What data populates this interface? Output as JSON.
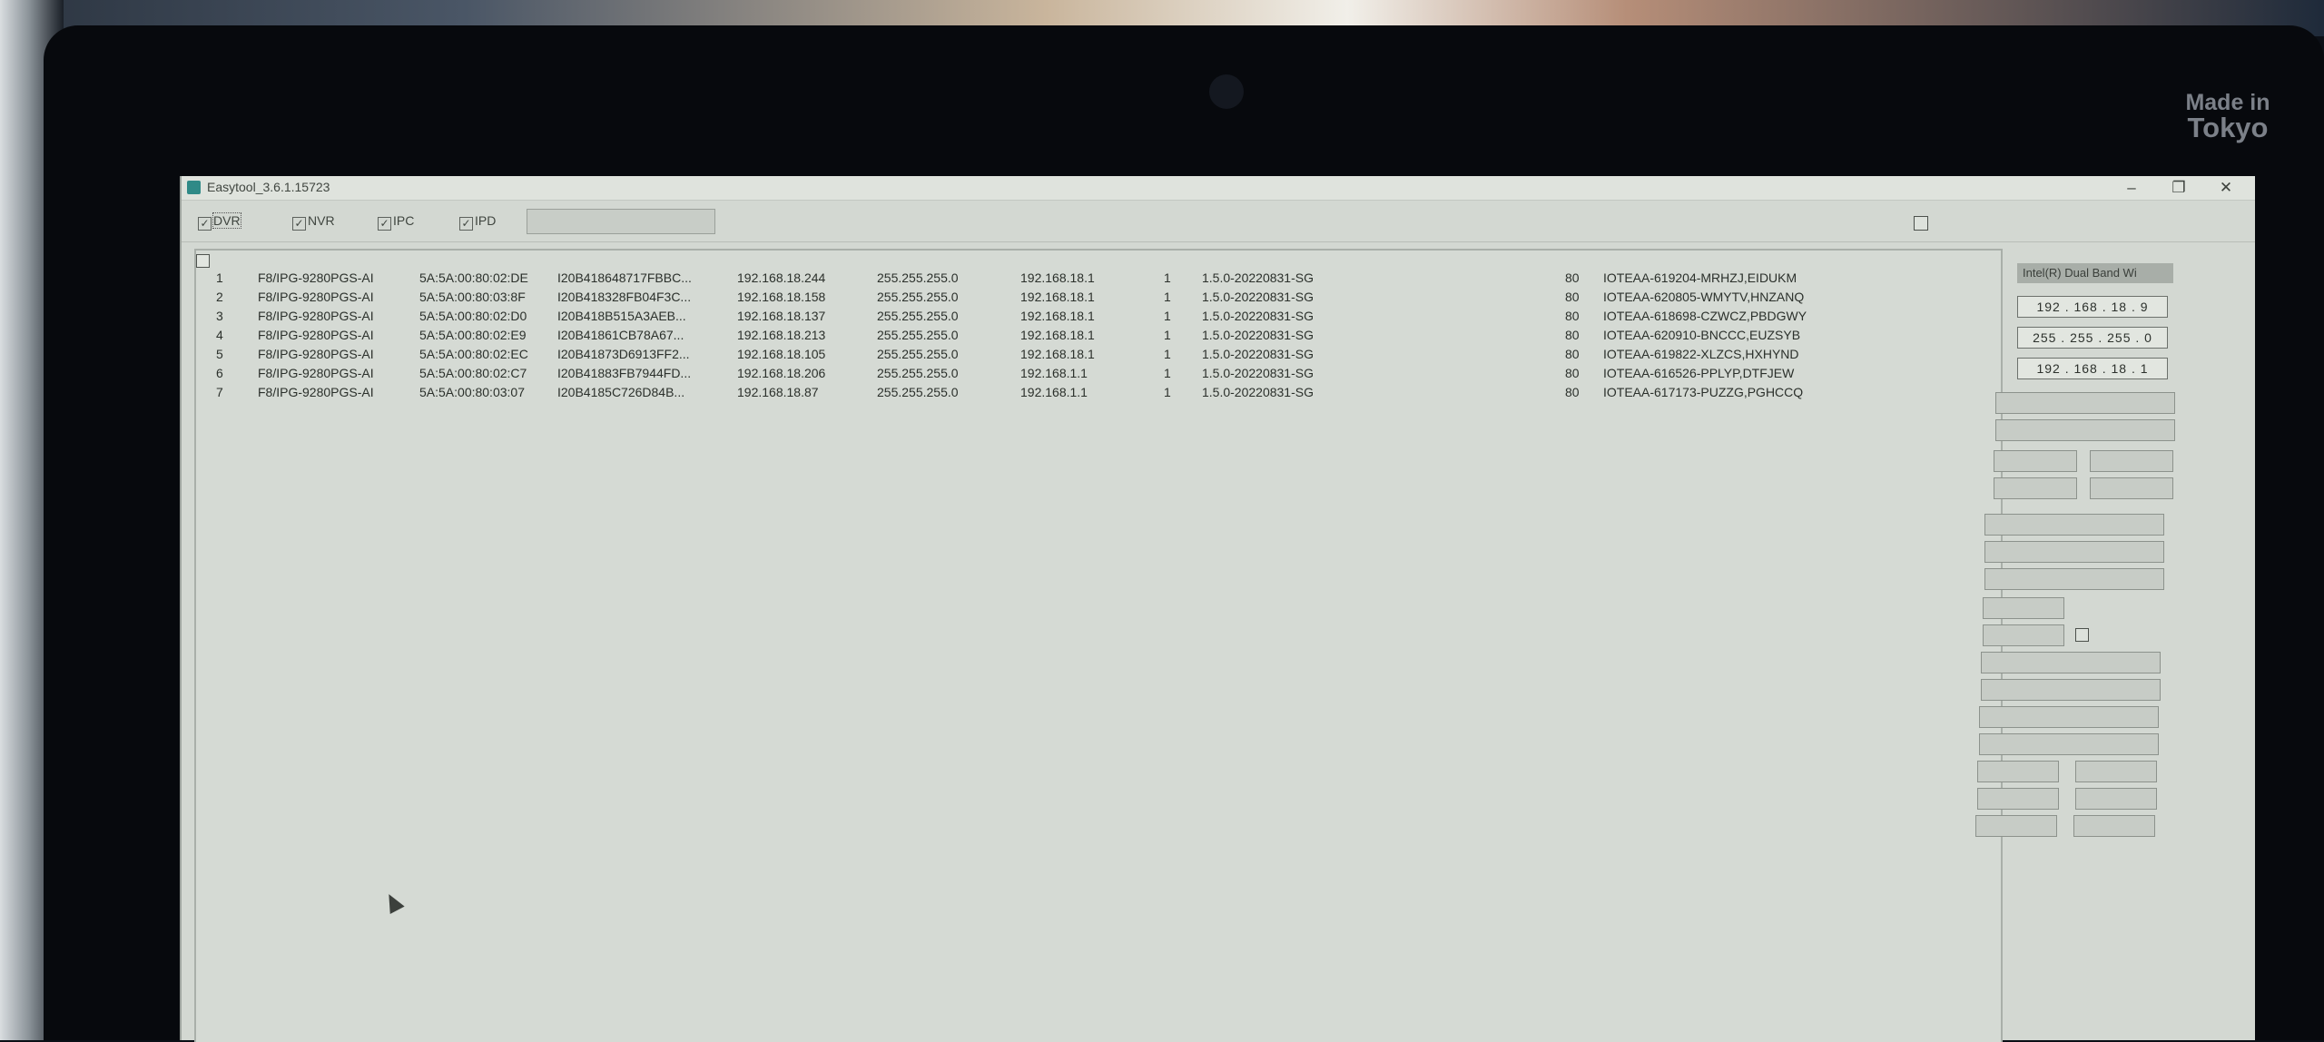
{
  "brand": {
    "line1": "Made in",
    "line2": "Tokyo"
  },
  "window": {
    "title": "Easytool_3.6.1.15723",
    "minimize": "–",
    "maximize": "❐",
    "close": "✕"
  },
  "filters": [
    {
      "label": "DVR",
      "checked": true
    },
    {
      "label": "NVR",
      "checked": true
    },
    {
      "label": "IPC",
      "checked": true
    },
    {
      "label": "IPD",
      "checked": true
    }
  ],
  "search": {
    "value": ""
  },
  "devices": [
    {
      "no": "1",
      "model": "F8/IPG-9280PGS-AI",
      "mac": "5A:5A:00:80:02:DE",
      "serial": "I20B418648717FBBC...",
      "ip": "192.168.18.244",
      "mask": "255.255.255.0",
      "gateway": "192.168.18.1",
      "channels": "1",
      "version": "1.5.0-20220831-SG",
      "port": "80",
      "name": "IOTEAA-619204-MRHZJ,EIDUKM"
    },
    {
      "no": "2",
      "model": "F8/IPG-9280PGS-AI",
      "mac": "5A:5A:00:80:03:8F",
      "serial": "I20B418328FB04F3C...",
      "ip": "192.168.18.158",
      "mask": "255.255.255.0",
      "gateway": "192.168.18.1",
      "channels": "1",
      "version": "1.5.0-20220831-SG",
      "port": "80",
      "name": "IOTEAA-620805-WMYTV,HNZANQ"
    },
    {
      "no": "3",
      "model": "F8/IPG-9280PGS-AI",
      "mac": "5A:5A:00:80:02:D0",
      "serial": "I20B418B515A3AEB...",
      "ip": "192.168.18.137",
      "mask": "255.255.255.0",
      "gateway": "192.168.18.1",
      "channels": "1",
      "version": "1.5.0-20220831-SG",
      "port": "80",
      "name": "IOTEAA-618698-CZWCZ,PBDGWY"
    },
    {
      "no": "4",
      "model": "F8/IPG-9280PGS-AI",
      "mac": "5A:5A:00:80:02:E9",
      "serial": "I20B41861CB78A67...",
      "ip": "192.168.18.213",
      "mask": "255.255.255.0",
      "gateway": "192.168.18.1",
      "channels": "1",
      "version": "1.5.0-20220831-SG",
      "port": "80",
      "name": "IOTEAA-620910-BNCCC,EUZSYB"
    },
    {
      "no": "5",
      "model": "F8/IPG-9280PGS-AI",
      "mac": "5A:5A:00:80:02:EC",
      "serial": "I20B41873D6913FF2...",
      "ip": "192.168.18.105",
      "mask": "255.255.255.0",
      "gateway": "192.168.18.1",
      "channels": "1",
      "version": "1.5.0-20220831-SG",
      "port": "80",
      "name": "IOTEAA-619822-XLZCS,HXHYND"
    },
    {
      "no": "6",
      "model": "F8/IPG-9280PGS-AI",
      "mac": "5A:5A:00:80:02:C7",
      "serial": "I20B41883FB7944FD...",
      "ip": "192.168.18.206",
      "mask": "255.255.255.0",
      "gateway": "192.168.1.1",
      "channels": "1",
      "version": "1.5.0-20220831-SG",
      "port": "80",
      "name": "IOTEAA-616526-PPLYP,DTFJEW"
    },
    {
      "no": "7",
      "model": "F8/IPG-9280PGS-AI",
      "mac": "5A:5A:00:80:03:07",
      "serial": "I20B4185C726D84B...",
      "ip": "192.168.18.87",
      "mask": "255.255.255.0",
      "gateway": "192.168.1.1",
      "channels": "1",
      "version": "1.5.0-20220831-SG",
      "port": "80",
      "name": "IOTEAA-617173-PUZZG,PGHCCQ"
    }
  ],
  "side_panel": {
    "adapter": "Intel(R) Dual Band Wi",
    "ip": "192 . 168 . 18 . 9",
    "mask": "255 . 255 . 255 . 0",
    "gateway": "192 . 168 . 18 . 1"
  }
}
